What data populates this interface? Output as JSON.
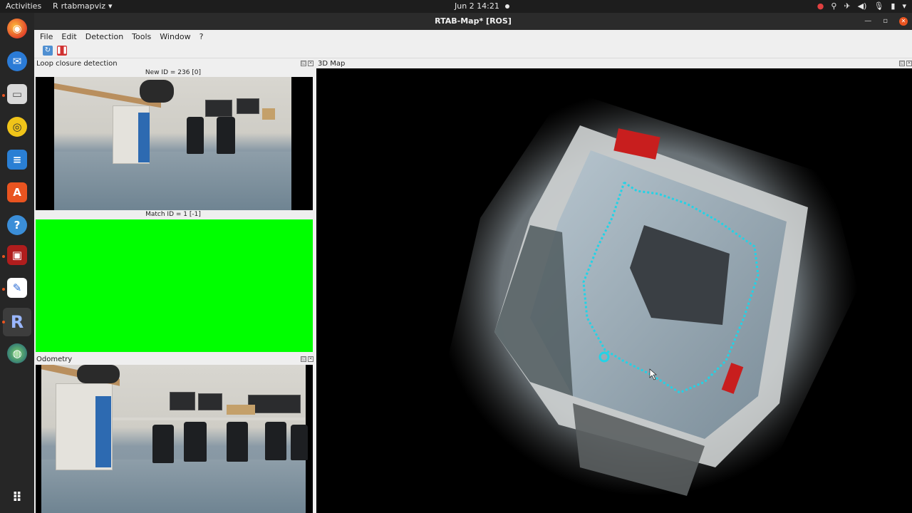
{
  "topbar": {
    "activities": "Activities",
    "app_menu": "rtabmapviz",
    "clock": "Jun 2  14:21"
  },
  "window": {
    "title": "RTAB-Map* [ROS]"
  },
  "menu": {
    "file": "File",
    "edit": "Edit",
    "detection": "Detection",
    "tools": "Tools",
    "window": "Window",
    "help": "?"
  },
  "panels": {
    "loop_closure": {
      "title": "Loop closure detection",
      "new_id": "New ID = 236 [0]",
      "match_id": "Match ID = 1 [-1]"
    },
    "odometry": {
      "title": "Odometry"
    },
    "map3d": {
      "title": "3D Map"
    }
  },
  "colors": {
    "match_fill": "#00ff00",
    "trajectory": "#22d3e6",
    "accent": "#e95420"
  },
  "dock_icons": [
    "firefox-icon",
    "thunderbird-icon",
    "files-icon",
    "rhythmbox-icon",
    "writer-icon",
    "software-icon",
    "help-icon",
    "terminal-icon",
    "editor-icon",
    "rtabmap-icon",
    "web-icon",
    "apps-grid-icon"
  ]
}
